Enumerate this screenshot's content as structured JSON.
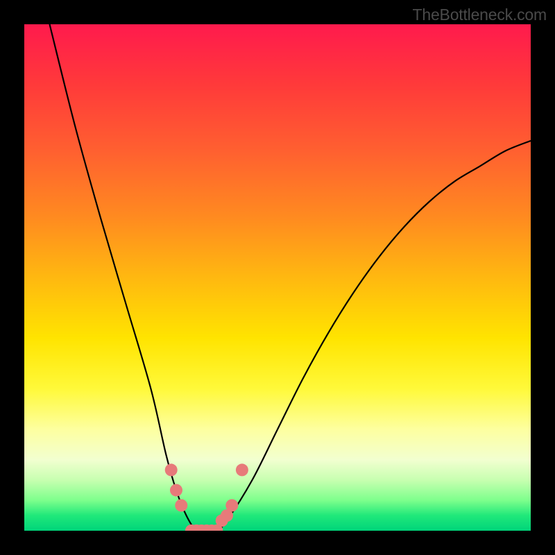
{
  "watermark": "TheBottleneck.com",
  "chart_data": {
    "type": "line",
    "title": "",
    "xlabel": "",
    "ylabel": "",
    "xlim": [
      0,
      100
    ],
    "ylim": [
      0,
      100
    ],
    "grid": false,
    "series": [
      {
        "name": "bottleneck-curve",
        "color": "#000000",
        "x": [
          5,
          10,
          15,
          20,
          25,
          28,
          30,
          32,
          34,
          36,
          38,
          40,
          45,
          50,
          55,
          60,
          65,
          70,
          75,
          80,
          85,
          90,
          95,
          100
        ],
        "y": [
          100,
          80,
          62,
          45,
          28,
          15,
          8,
          3,
          0,
          0,
          0,
          2,
          10,
          20,
          30,
          39,
          47,
          54,
          60,
          65,
          69,
          72,
          75,
          77
        ]
      }
    ],
    "markers": {
      "name": "highlight-dots",
      "color": "#e77a7a",
      "radius_px": 9,
      "points": [
        {
          "x": 29,
          "y": 12
        },
        {
          "x": 30,
          "y": 8
        },
        {
          "x": 31,
          "y": 5
        },
        {
          "x": 33,
          "y": 0
        },
        {
          "x": 34,
          "y": 0
        },
        {
          "x": 35,
          "y": 0
        },
        {
          "x": 36,
          "y": 0
        },
        {
          "x": 37,
          "y": 0
        },
        {
          "x": 38,
          "y": 0
        },
        {
          "x": 39,
          "y": 2
        },
        {
          "x": 40,
          "y": 3
        },
        {
          "x": 41,
          "y": 5
        },
        {
          "x": 43,
          "y": 12
        }
      ]
    },
    "background": {
      "type": "vertical-gradient",
      "stops": [
        {
          "pos": 0.0,
          "color": "#ff1a4d"
        },
        {
          "pos": 0.5,
          "color": "#ffe400"
        },
        {
          "pos": 0.86,
          "color": "#f2ffd0"
        },
        {
          "pos": 1.0,
          "color": "#00d47a"
        }
      ]
    }
  }
}
